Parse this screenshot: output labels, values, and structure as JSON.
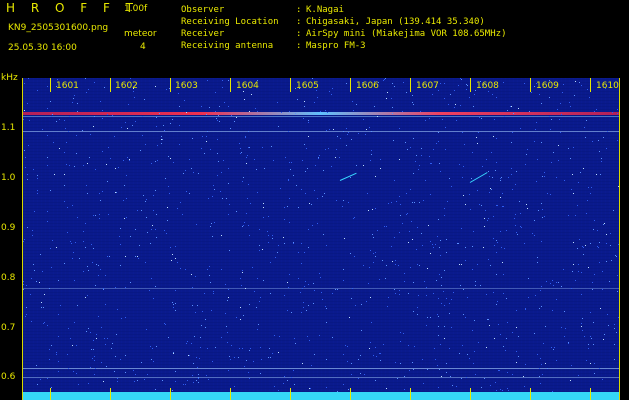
{
  "app": {
    "title": "H R O F F T",
    "version": "1.00f",
    "filename": "KN9_2505301600.png",
    "timestamp": "25.05.30 16:00",
    "mode": "meteor",
    "mode_value": "4"
  },
  "meta": [
    {
      "label": "Observer",
      "value": "K.Nagai"
    },
    {
      "label": "Receiving Location",
      "value": "Chigasaki, Japan (139.414 35.340)"
    },
    {
      "label": "Receiver",
      "value": "AirSpy mini (Miakejima VOR 108.65MHz)"
    },
    {
      "label": "Receiving antenna",
      "value": "Maspro FM-3"
    }
  ],
  "axes": {
    "y_unit": "kHz",
    "y_ticks": [
      "1.1",
      "1.0",
      "0.9",
      "0.8",
      "0.7",
      "0.6"
    ],
    "x_ticks": [
      "1601",
      "1602",
      "1603",
      "1604",
      "1605",
      "1606",
      "1607",
      "1608",
      "1609",
      "1610"
    ]
  },
  "colors": {
    "text": "#e8e800",
    "background": "#0a1a8c",
    "carrier": "#d02050",
    "echo": "#38d8ff",
    "floor": "#35d6f7"
  }
}
